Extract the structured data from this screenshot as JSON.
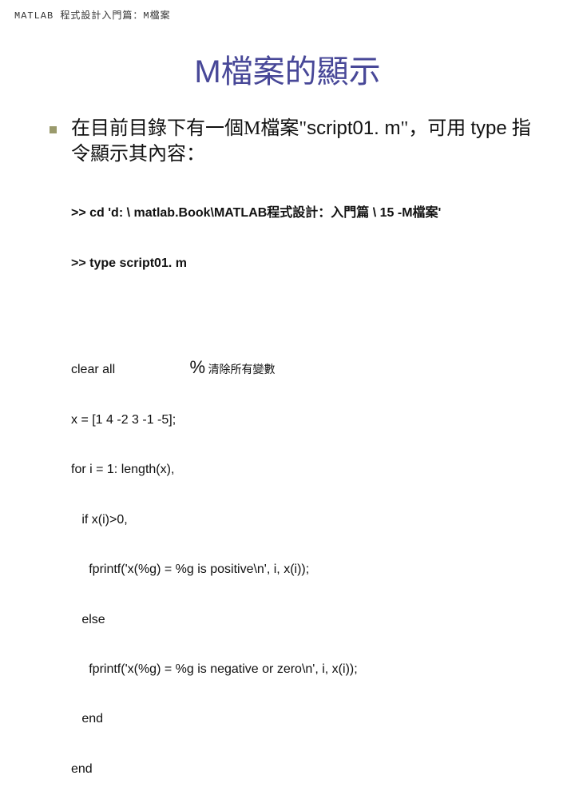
{
  "header": "MATLAB 程式設計入門篇：M檔案",
  "title": "M檔案的顯示",
  "bullet": {
    "part1": "在目前目錄下有一個M檔案\"",
    "filename": "script01. m",
    "part2": "\"，可用 ",
    "cmd": "type",
    "part3": " 指令顯示其內容："
  },
  "commands": [
    ">> cd 'd: \\ matlab.Book\\MATLAB程式設計：入門篇 \\ 15 -M檔案'",
    ">> type script01. m"
  ],
  "code": {
    "l1a": "clear all",
    "l1_pct": "%",
    "l1_comment": " 清除所有變數",
    "l2": "x = [1 4 -2 3 -1 -5];",
    "l3": "for i = 1: length(x),",
    "l4": "   if x(i)>0,",
    "l5": "     fprintf('x(%g) = %g is positive\\n', i, x(i));",
    "l6": "   else",
    "l7": "     fprintf('x(%g) = %g is negative or zero\\n', i, x(i));",
    "l8": "   end",
    "l9": "end"
  }
}
